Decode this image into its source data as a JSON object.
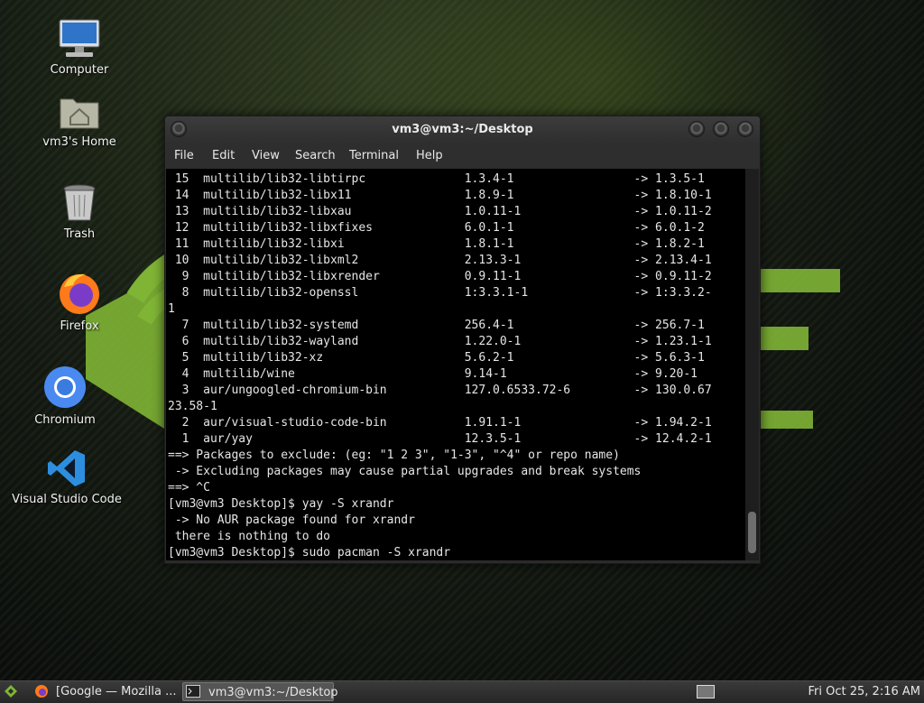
{
  "desktop": {
    "icons": [
      {
        "label": "Computer",
        "icon": "computer-icon"
      },
      {
        "label": "vm3's Home",
        "icon": "home-folder-icon"
      },
      {
        "label": "Trash",
        "icon": "trash-icon"
      },
      {
        "label": "Firefox",
        "icon": "firefox-icon"
      },
      {
        "label": "Chromium",
        "icon": "chromium-icon"
      },
      {
        "label": "Visual Studio Code",
        "icon": "vscode-icon"
      }
    ]
  },
  "terminal": {
    "title": "vm3@vm3:~/Desktop",
    "menu": [
      "File",
      "Edit",
      "View",
      "Search",
      "Terminal",
      "Help"
    ],
    "lines": [
      " 15  multilib/lib32-libtirpc              1.3.4-1                 -> 1.3.5-1",
      " 14  multilib/lib32-libx11                1.8.9-1                 -> 1.8.10-1",
      " 13  multilib/lib32-libxau                1.0.11-1                -> 1.0.11-2",
      " 12  multilib/lib32-libxfixes             6.0.1-1                 -> 6.0.1-2",
      " 11  multilib/lib32-libxi                 1.8.1-1                 -> 1.8.2-1",
      " 10  multilib/lib32-libxml2               2.13.3-1                -> 2.13.4-1",
      "  9  multilib/lib32-libxrender            0.9.11-1                -> 0.9.11-2",
      "  8  multilib/lib32-openssl               1:3.3.1-1               -> 1:3.3.2-",
      "1",
      "  7  multilib/lib32-systemd               256.4-1                 -> 256.7-1",
      "  6  multilib/lib32-wayland               1.22.0-1                -> 1.23.1-1",
      "  5  multilib/lib32-xz                    5.6.2-1                 -> 5.6.3-1",
      "  4  multilib/wine                        9.14-1                  -> 9.20-1",
      "  3  aur/ungoogled-chromium-bin           127.0.6533.72-6         -> 130.0.67",
      "23.58-1",
      "  2  aur/visual-studio-code-bin           1.91.1-1                -> 1.94.2-1",
      "  1  aur/yay                              12.3.5-1                -> 12.4.2-1",
      "==> Packages to exclude: (eg: \"1 2 3\", \"1-3\", \"^4\" or repo name)",
      " -> Excluding packages may cause partial upgrades and break systems",
      "==> ^C",
      "[vm3@vm3 Desktop]$ yay -S xrandr",
      " -> No AUR package found for xrandr",
      " there is nothing to do",
      "[vm3@vm3 Desktop]$ sudo pacman -S xrandr"
    ]
  },
  "taskbar": {
    "tasks": [
      {
        "label": "[Google — Mozilla ...",
        "icon": "firefox-icon"
      },
      {
        "label": "vm3@vm3:~/Desktop",
        "icon": "terminal-icon"
      }
    ],
    "clock": "Fri Oct 25,  2:16 AM"
  },
  "colors": {
    "terminal_bg": "#000000",
    "terminal_fg": "#e6e6e6",
    "wallpaper_accent": "#7fb435"
  }
}
